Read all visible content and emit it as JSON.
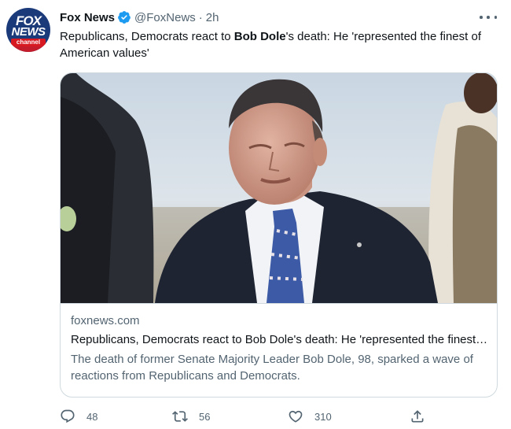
{
  "tweet": {
    "author_name": "Fox News",
    "handle": "@FoxNews",
    "separator": "·",
    "time": "2h",
    "text_part1": "Republicans, Democrats react to ",
    "text_bold": "Bob Dole",
    "text_part2": "'s death: He 'represented the finest of American values'",
    "avatar": {
      "logo_line1": "FOX",
      "logo_line2": "NEWS",
      "logo_line3": "channel"
    }
  },
  "card": {
    "domain": "foxnews.com",
    "title": "Republicans, Democrats react to Bob Dole's death: He 'represented the finest of American values'",
    "description": "The death of former Senate Majority Leader Bob Dole, 98, sparked a wave of reactions from Republicans and Democrats."
  },
  "actions": {
    "replies": "48",
    "retweets": "56",
    "likes": "310"
  },
  "icons": {
    "verified": "verified-badge-icon",
    "more": "more-options-icon",
    "reply": "reply-icon",
    "retweet": "retweet-icon",
    "like": "heart-icon",
    "share": "share-icon"
  },
  "colors": {
    "verified_blue": "#1d9bf0",
    "secondary_text": "#536471",
    "border": "#cfd9de",
    "fox_navy": "#1b3a7a",
    "fox_red": "#d71921"
  }
}
